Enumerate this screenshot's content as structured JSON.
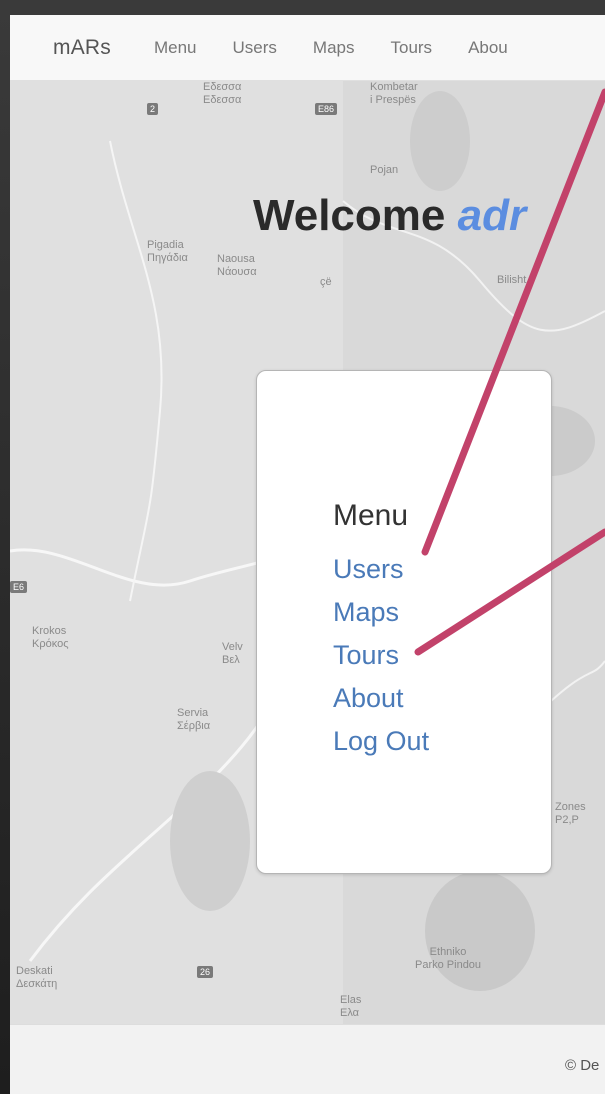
{
  "navbar": {
    "brand": "mARs",
    "links": [
      "Menu",
      "Users",
      "Maps",
      "Tours",
      "Abou"
    ]
  },
  "map": {
    "places": [
      {
        "text": "Εδεσσα\nΕδεσσα"
      },
      {
        "text": "Kombetar\ni Prespës"
      },
      {
        "text": "Pojan"
      },
      {
        "text": "Pigadia\nΠηγάδια"
      },
      {
        "text": "Naousa\nΝάουσα"
      },
      {
        "text": "çë"
      },
      {
        "text": "Bilisht"
      },
      {
        "text": "Krokos\nΚρόκος"
      },
      {
        "text": "Velv\nΒελ"
      },
      {
        "text": "Servia\nΣέρβια"
      },
      {
        "text": "Zones\nP2,P"
      },
      {
        "text": "Ethniko\nParko Pindou"
      },
      {
        "text": "Deskati\nΔεσκάτη"
      },
      {
        "text": "Elas\nΕλα"
      }
    ],
    "shields": [
      "2",
      "E86",
      "E6",
      "26"
    ]
  },
  "welcome": {
    "prefix": "Welcome ",
    "user": "adr"
  },
  "menu_card": {
    "title": "Menu",
    "items": [
      "Users",
      "Maps",
      "Tours",
      "About",
      "Log Out"
    ]
  },
  "footer": {
    "text": "© De"
  },
  "colors": {
    "accent": "#5b8de0",
    "link": "#4a7ab8",
    "arrow": "#c2426a"
  }
}
